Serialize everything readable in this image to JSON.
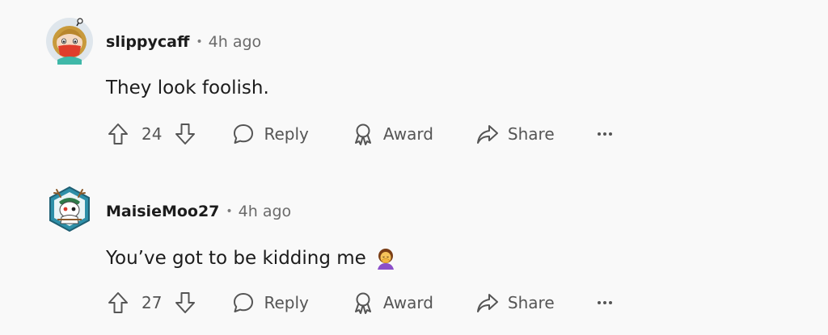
{
  "comments": [
    {
      "username": "slippycaff",
      "separator": "•",
      "time": "4h ago",
      "text": "They look foolish.",
      "votes": "24",
      "reply_label": "Reply",
      "award_label": "Award",
      "share_label": "Share",
      "more_label": "•••",
      "avatar_icon": "snoo-avatar-red-mask"
    },
    {
      "username": "MaisieMoo27",
      "separator": "•",
      "time": "4h ago",
      "text": "You’ve got to be kidding me",
      "votes": "27",
      "reply_label": "Reply",
      "award_label": "Award",
      "share_label": "Share",
      "more_label": "•••",
      "avatar_icon": "snoo-avatar-hexagon-deer",
      "emoji": "person-facepalming-emoji"
    }
  ],
  "colors": {
    "background": "#f9f9f9",
    "text": "#1c1c1c",
    "muted": "#555555"
  }
}
